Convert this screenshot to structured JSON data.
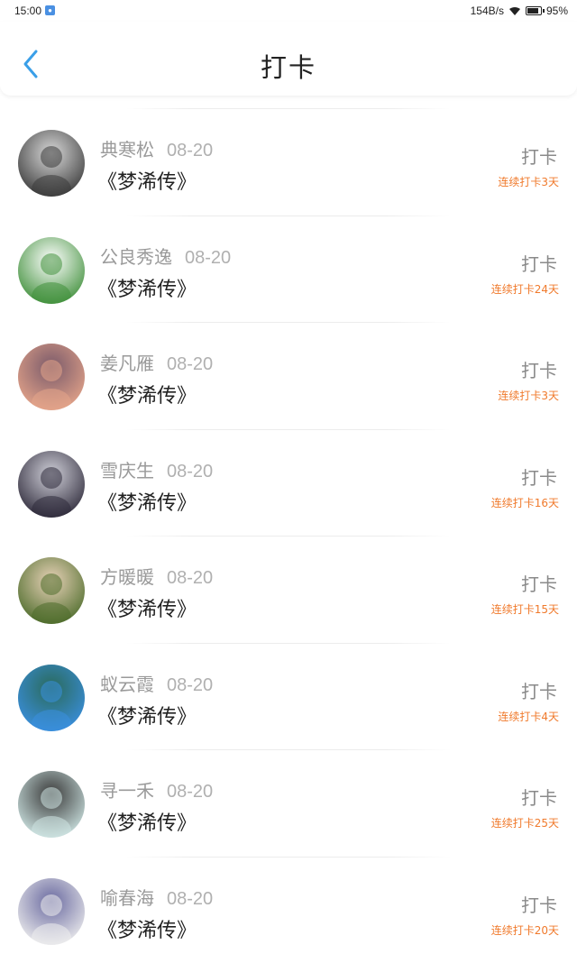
{
  "status_bar": {
    "time": "15:00",
    "network_speed": "154B/s",
    "battery": "95%",
    "battery_level": 0.95
  },
  "header": {
    "title": "打卡",
    "back_icon": "chevron-left-icon",
    "accent_color": "#3a9fe8"
  },
  "items": [
    {
      "name": "典寒松",
      "date": "08-20",
      "book": "《梦浠传》",
      "action": "打卡",
      "streak": "连续打卡3天",
      "avatar_colors": [
        "#3a3a3a",
        "#d8d8d8"
      ]
    },
    {
      "name": "公良秀逸",
      "date": "08-20",
      "book": "《梦浠传》",
      "action": "打卡",
      "streak": "连续打卡24天",
      "avatar_colors": [
        "#3f8f3a",
        "#ffffff"
      ]
    },
    {
      "name": "姜凡雁",
      "date": "08-20",
      "book": "《梦浠传》",
      "action": "打卡",
      "streak": "连续打卡3天",
      "avatar_colors": [
        "#e6a58a",
        "#7a5a6a"
      ]
    },
    {
      "name": "雪庆生",
      "date": "08-20",
      "book": "《梦浠传》",
      "action": "打卡",
      "streak": "连续打卡16天",
      "avatar_colors": [
        "#2e2a3a",
        "#cfcfd8"
      ]
    },
    {
      "name": "方暖暖",
      "date": "08-20",
      "book": "《梦浠传》",
      "action": "打卡",
      "streak": "连续打卡15天",
      "avatar_colors": [
        "#4c6b2a",
        "#e8d2b8"
      ]
    },
    {
      "name": "蚁云霞",
      "date": "08-20",
      "book": "《梦浠传》",
      "action": "打卡",
      "streak": "连续打卡4天",
      "avatar_colors": [
        "#3a8fe0",
        "#2a6a5a"
      ]
    },
    {
      "name": "寻一禾",
      "date": "08-20",
      "book": "《梦浠传》",
      "action": "打卡",
      "streak": "连续打卡25天",
      "avatar_colors": [
        "#cfe6e4",
        "#3a3a3a"
      ]
    },
    {
      "name": "喻春海",
      "date": "08-20",
      "book": "《梦浠传》",
      "action": "打卡",
      "streak": "连续打卡20天",
      "avatar_colors": [
        "#eeeeee",
        "#6a6aa0"
      ]
    }
  ]
}
